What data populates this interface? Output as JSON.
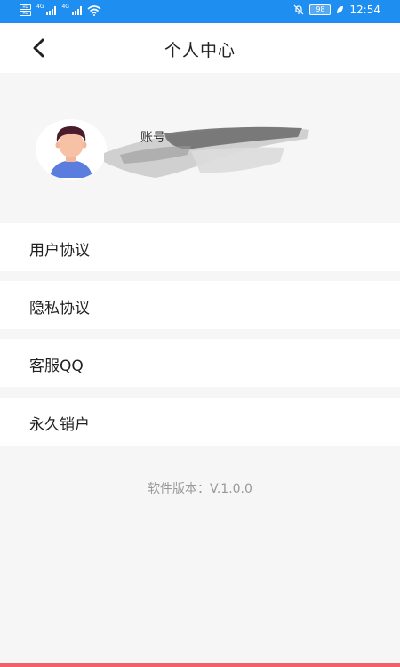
{
  "status_bar": {
    "sim1": "HD",
    "sim2": "HD",
    "network1": "4G",
    "network2": "4G",
    "battery": "98",
    "time": "12:54"
  },
  "header": {
    "title": "个人中心",
    "back_icon": "chevron-left-icon"
  },
  "profile": {
    "account_label": "账号",
    "avatar_icon": "user-avatar-icon"
  },
  "menu": {
    "items": [
      {
        "label": "用户协议"
      },
      {
        "label": "隐私协议"
      },
      {
        "label": "客服QQ"
      },
      {
        "label": "永久销户"
      }
    ]
  },
  "footer": {
    "version": "软件版本：V.1.0.0"
  },
  "colors": {
    "status_bar": "#1e8ef0",
    "page_bg": "#f6f6f6",
    "bottom_bar": "#f2606a"
  }
}
